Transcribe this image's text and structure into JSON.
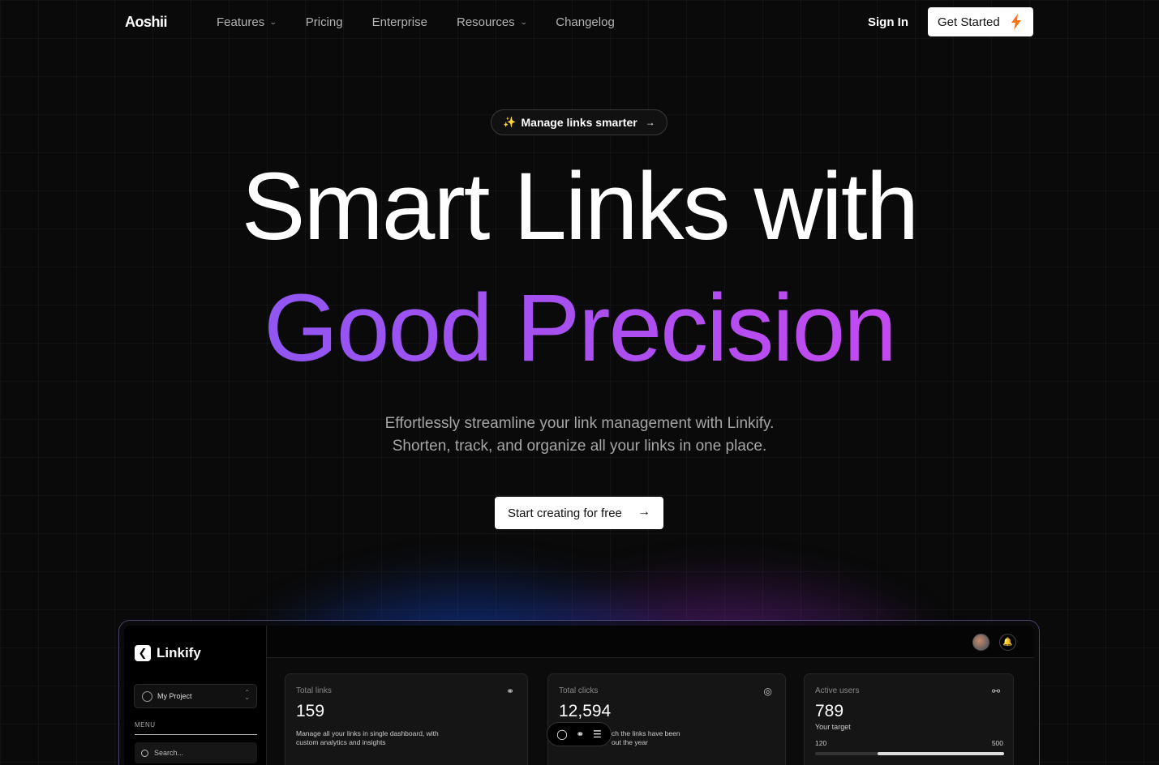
{
  "nav": {
    "logo": "Aoshii",
    "links": [
      "Features",
      "Pricing",
      "Enterprise",
      "Resources",
      "Changelog"
    ],
    "signin": "Sign In",
    "get_started": "Get Started"
  },
  "hero": {
    "badge": "Manage links smarter",
    "headline_1": "Smart Links with",
    "headline_2": "Good Precision",
    "sub_1": "Effortlessly streamline your link management with Linkify.",
    "sub_2": "Shorten, track, and organize all your links in one place.",
    "cta": "Start creating for free"
  },
  "dashboard": {
    "app_name": "Linkify",
    "project": "My Project",
    "menu_label": "MENU",
    "search_placeholder": "Search...",
    "cards": [
      {
        "title": "Total links",
        "value": "159",
        "desc": "Manage all your links in single dashboard, with custom analytics and insights"
      },
      {
        "title": "Total clicks",
        "value": "12,594",
        "desc": "ch the links have been\nout the year"
      },
      {
        "title": "Active users",
        "value": "789",
        "target": "Your target",
        "min": "120",
        "max": "500",
        "progress": 0.33
      }
    ]
  },
  "colors": {
    "accent_start": "#7c5cf5",
    "accent_end": "#d946ef",
    "bolt": "#f97316"
  }
}
